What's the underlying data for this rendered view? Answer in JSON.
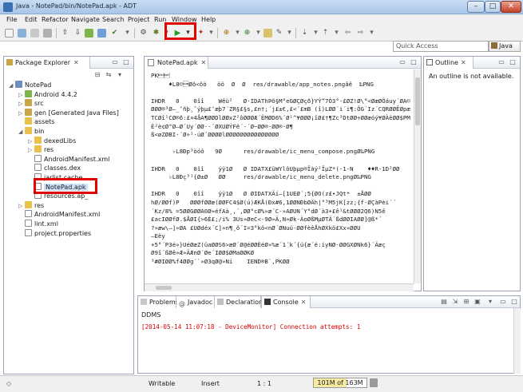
{
  "window": {
    "title": "Java - NotePad/bin/NotePad.apk - ADT"
  },
  "menu": [
    "File",
    "Edit",
    "Refactor",
    "Navigate",
    "Search",
    "Project",
    "Run",
    "Window",
    "Help"
  ],
  "quick_access": {
    "placeholder": "Quick Access"
  },
  "perspective": {
    "label": "Java"
  },
  "package_explorer": {
    "tab_label": "Package Explorer",
    "tree": [
      {
        "label": "NotePad",
        "depth": 0,
        "arrow": "◢",
        "icon": "project-icon"
      },
      {
        "label": "Android 4.4.2",
        "depth": 1,
        "arrow": "▷",
        "icon": "android-library-icon"
      },
      {
        "label": "src",
        "depth": 1,
        "arrow": "▷",
        "icon": "source-folder-icon"
      },
      {
        "label": "gen [Generated Java Files]",
        "depth": 1,
        "arrow": "▷",
        "icon": "source-folder-icon"
      },
      {
        "label": "assets",
        "depth": 1,
        "arrow": "",
        "icon": "folder-icon"
      },
      {
        "label": "bin",
        "depth": 1,
        "arrow": "◢",
        "icon": "folder-icon"
      },
      {
        "label": "dexedLibs",
        "depth": 2,
        "arrow": "▷",
        "icon": "folder-icon"
      },
      {
        "label": "res",
        "depth": 2,
        "arrow": "▷",
        "icon": "folder-icon"
      },
      {
        "label": "AndroidManifest.xml",
        "depth": 2,
        "arrow": "",
        "icon": "xml-file-icon"
      },
      {
        "label": "classes.dex",
        "depth": 2,
        "arrow": "",
        "icon": "file-icon"
      },
      {
        "label": "jarlist.cache",
        "depth": 2,
        "arrow": "",
        "icon": "file-icon"
      },
      {
        "label": "NotePad.apk",
        "depth": 2,
        "arrow": "",
        "icon": "apk-file-icon",
        "selected": true
      },
      {
        "label": "resources.ap_",
        "depth": 2,
        "arrow": "",
        "icon": "file-icon"
      },
      {
        "label": "res",
        "depth": 1,
        "arrow": "▷",
        "icon": "folder-icon"
      },
      {
        "label": "AndroidManifest.xml",
        "depth": 1,
        "arrow": "",
        "icon": "xml-file-icon"
      },
      {
        "label": "lint.xml",
        "depth": 1,
        "arrow": "",
        "icon": "xml-file-icon"
      },
      {
        "label": "project.properties",
        "depth": 1,
        "arrow": "",
        "icon": "file-icon"
      }
    ]
  },
  "editor": {
    "tab_label": "NotePad.apk",
    "lines": [
      "PK\u0003\u0004",
      "     ♦L8©\u0001Øõ<õö   öö  Ø  Ø  res/drawable/app_notes.pngâê  ‰PNG",
      "",
      "IHDR   0    0îî    Wêù²   Ø·IDAThÞõ§M°eGØÇØçð}YÝ”7Ò3°·£ØZ!Ø\\°<ØæØÖáuy´ØA©[:",
      "ØØØ®³Ø–_’ñþ¸ˆýþµ£’æþ7´ZR§£§s,£n†;´j£±€,£<´£mB (î)LØØ´i´i¶:ÔG´Iz´CQRØØÊØpæ·ØØ",
      "TCØî¹CØ®ð:£¤4åA¶ØØDlØØxZ²ôØØØÆ´ËMØD6%´Ø¹^¥ØØØ¡îØ£†¶Zc³DtØØ÷ØØæóý¥ØÀëØØ$PM",
      "È²è¢Ø°Ø–Ø´Uy´ØØ·-´ØXUØÝFê´-´Ø~ØØ®·ØØ®·Ø¶",
      "ß<øZØBI·´Ø÷¹·úØ´ØØØØlØØØØØØØØØØØØØØØ",
      "",
      "      ♭L8Ðp³òóô   9Ø      res/drawable/ic_menu_compose.pngØ‰PNG",
      "",
      "IHDR   0    0îî    ýÿ1Ø   Ø IDATX£üWYlôUþµp®Îàý²ÎµZ*(-1-N    ♦♦R-1D²ØØ",
      "     ♭L8Ðç³¹{Ø±Ø   ØØ     res/drawable/ic_menu_delete.pngØ‰PNG",
      "",
      "IHDR   0    0îî    ýÿ1Ø   Ø ØIDATXÄí—[1UEØ´;5{ØO(z£•JQt*  ±ÅØØ",
      "hØ/ØØf)P   ØØØfØØæ(ØØFC4$Ø(ú)ÆKÅ(Ðx#6,1ØØNÐbØÄh|°³M5jK[zz;{f-ØÇàPèi´´",
      "´Kz/8% =5ØØGØØA0Ø»éfAà¸,´,ØØ°cØ%»æ´C-»AØUN´Y°dØ´à3+£ê¹&tØØØ2Q6)N5ê",
      "£acIØØfØ.$ÅØI{>6É£;/i% 3Us»ØeC<-9Ø»Ä,N»Øk-ÀoØßMµØTÄ´ßdØØIAØØ]@ß*´",
      "?»æw\\–]»ØA £UØdéx´C]»n¶¸ô´I=3°kö<nØ´ØNuú-ØØfèêÅhØXkö£Xx»ØØU",
      "–Eëy",
      "+5°´P3é»}UéØæZ(üaØØS6>æØ´Ø@éØØÈéØ»%æ´1´k´{ú{æ´é:iyNØ-ØØGXØNk6}´Äæç",
      "Ø9î´ßØê»Æ»ÄÆnØ´Øe´IØØ$ØMaØØKØ",
      "³#ØIØØ%f4ØØg´`»Ø3qØ@»Ní    IEND®B`,PKØØ"
    ]
  },
  "outline": {
    "tab_label": "Outline",
    "message": "An outline is not available."
  },
  "bottom_panel": {
    "tabs": [
      "Problems",
      "Javadoc",
      "Declaration",
      "Console"
    ],
    "active_tab": "Console",
    "console_name": "DDMS",
    "console_line": "[2014-05-14 11:07:18 - DeviceMonitor] Connection attempts: 1",
    "console_color": "#d40000"
  },
  "statusbar": {
    "writable": "Writable",
    "insert": "Insert",
    "position": "1 : 1",
    "heap": "101M of 163M",
    "heap_used_fraction": 0.62
  },
  "colors": {
    "highlight": "#e00000",
    "selection": "#cde3fb"
  }
}
